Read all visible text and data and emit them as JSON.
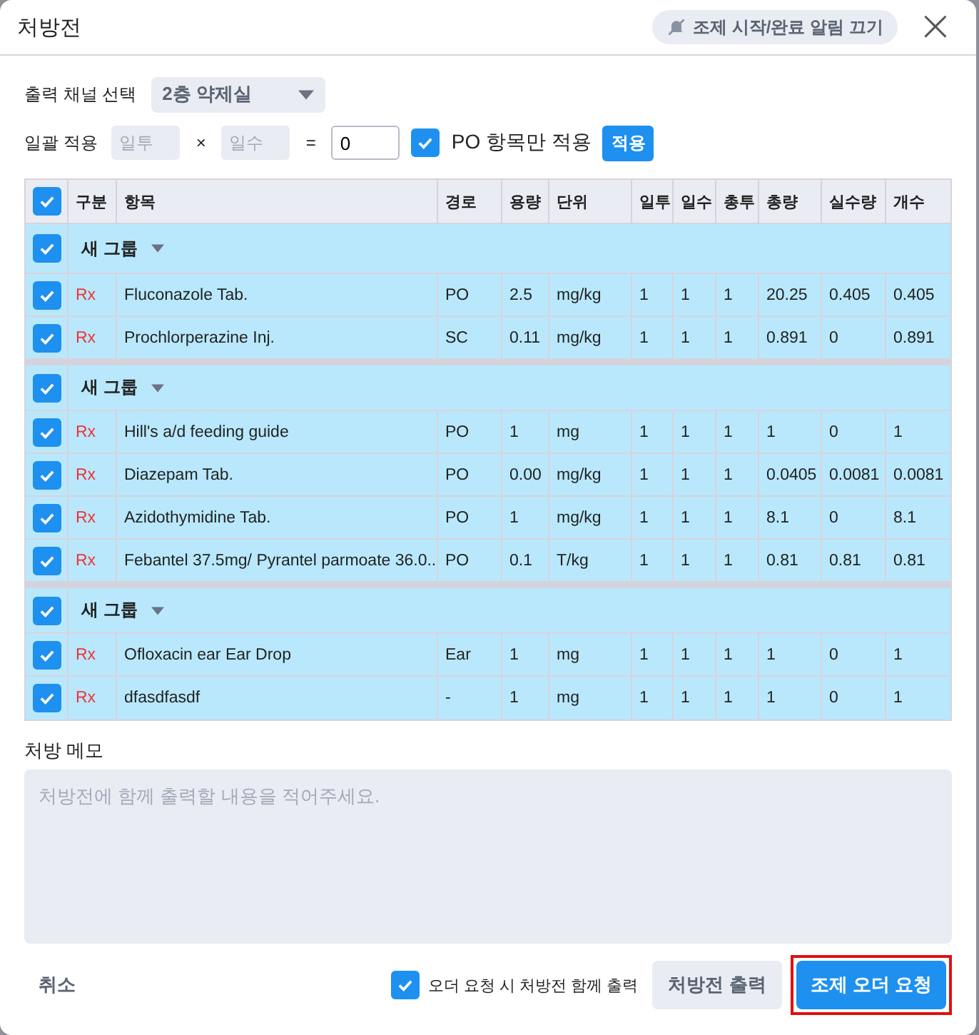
{
  "window": {
    "title": "처방전",
    "alert_button": "조제 시작/완료 알림 끄기",
    "close": "×"
  },
  "channel": {
    "label": "출력 채널 선택",
    "value": "2층 약제실"
  },
  "bulk": {
    "label": "일괄 적용",
    "daily_placeholder": "일투",
    "times": "×",
    "days_placeholder": "일수",
    "equals": "=",
    "total_value": "0",
    "po_only": {
      "label": "PO 항목만 적용",
      "checked": true
    },
    "apply": "적용"
  },
  "table": {
    "all_checked": true,
    "columns": [
      "구분",
      "항목",
      "경로",
      "용량",
      "단위",
      "일투",
      "일수",
      "총투",
      "총량",
      "실수량",
      "개수"
    ],
    "groups": [
      {
        "label": "새 그룹",
        "checked": true,
        "rows": [
          {
            "checked": true,
            "cells": [
              "Rx",
              "Fluconazole Tab.",
              "PO",
              "2.5",
              "mg/kg",
              "1",
              "1",
              "1",
              "20.25",
              "0.405",
              "0.405"
            ]
          },
          {
            "checked": true,
            "cells": [
              "Rx",
              "Prochlorperazine Inj.",
              "SC",
              "0.11",
              "mg/kg",
              "1",
              "1",
              "1",
              "0.891",
              "0",
              "0.891"
            ]
          }
        ]
      },
      {
        "label": "새 그룹",
        "checked": true,
        "rows": [
          {
            "checked": true,
            "cells": [
              "Rx",
              "Hill's a/d feeding guide",
              "PO",
              "1",
              "mg",
              "1",
              "1",
              "1",
              "1",
              "0",
              "1"
            ]
          },
          {
            "checked": true,
            "cells": [
              "Rx",
              "Diazepam Tab.",
              "PO",
              "0.00",
              "mg/kg",
              "1",
              "1",
              "1",
              "0.0405",
              "0.0081",
              "0.0081"
            ]
          },
          {
            "checked": true,
            "cells": [
              "Rx",
              "Azidothymidine Tab.",
              "PO",
              "1",
              "mg/kg",
              "1",
              "1",
              "1",
              "8.1",
              "0",
              "8.1"
            ]
          },
          {
            "checked": true,
            "cells": [
              "Rx",
              "Febantel 37.5mg/ Pyrantel parmoate 36.0...",
              "PO",
              "0.1",
              "T/kg",
              "1",
              "1",
              "1",
              "0.81",
              "0.81",
              "0.81"
            ]
          }
        ]
      },
      {
        "label": "새 그룹",
        "checked": true,
        "rows": [
          {
            "checked": true,
            "cells": [
              "Rx",
              "Ofloxacin ear Ear Drop",
              "Ear",
              "1",
              "mg",
              "1",
              "1",
              "1",
              "1",
              "0",
              "1"
            ]
          },
          {
            "checked": true,
            "cells": [
              "Rx",
              "dfasdfasdf",
              "-",
              "1",
              "mg",
              "1",
              "1",
              "1",
              "1",
              "0",
              "1"
            ]
          }
        ]
      }
    ]
  },
  "memo": {
    "label": "처방 메모",
    "placeholder": "처방전에 함께 출력할 내용을 적어주세요."
  },
  "footer": {
    "cancel": "취소",
    "print_with_order": {
      "label": "오더 요청 시 처방전 함께 출력",
      "checked": true
    },
    "print": "처방전 출력",
    "submit": {
      "label": "조제 오더 요청",
      "highlighted": true
    }
  }
}
